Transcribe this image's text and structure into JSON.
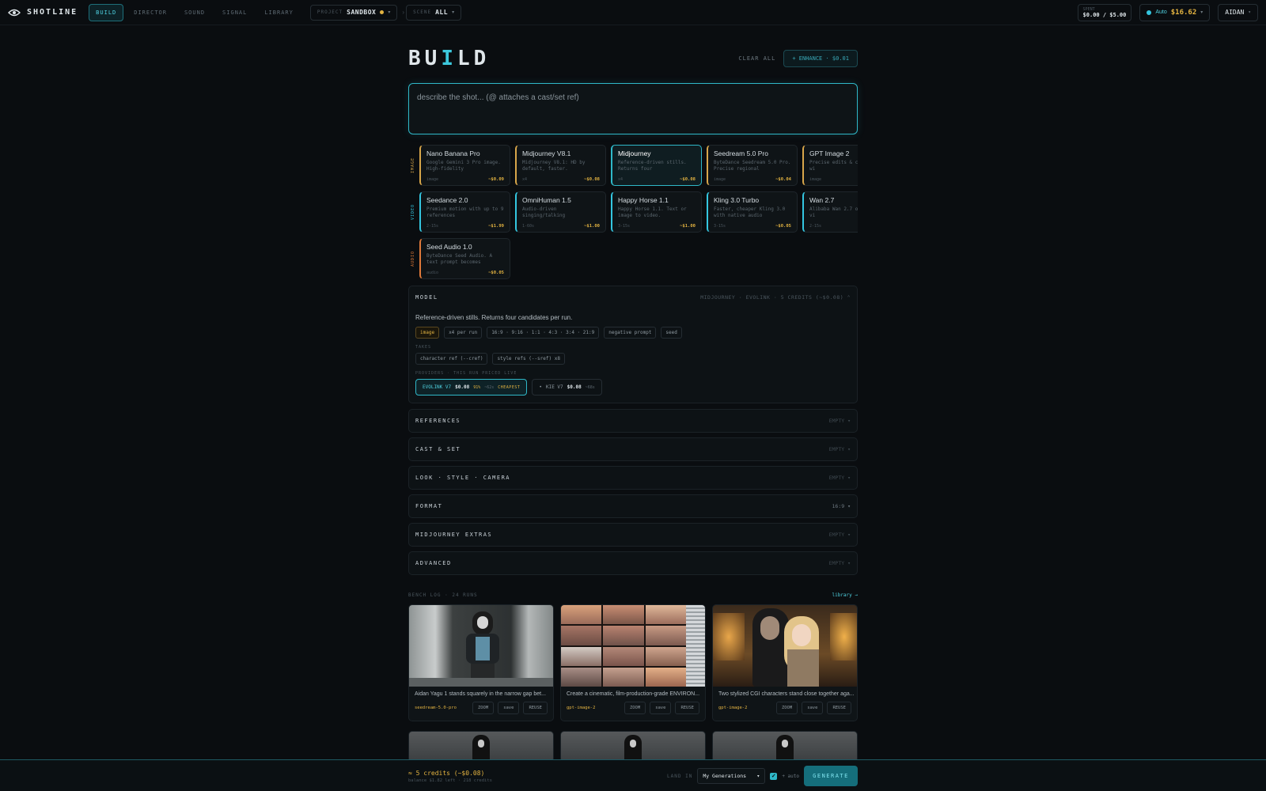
{
  "app": {
    "name": "SHOTLINE"
  },
  "nav": [
    {
      "label": "BUILD",
      "active": true
    },
    {
      "label": "DIRECTOR"
    },
    {
      "label": "SOUND"
    },
    {
      "label": "SIGNAL"
    },
    {
      "label": "LIBRARY"
    }
  ],
  "project": {
    "label": "PROJECT",
    "value": "SANDBOX"
  },
  "scene": {
    "label": "SCENE",
    "value": "ALL"
  },
  "spent": {
    "label": "SPENT",
    "value": "$0.00 / $5.00"
  },
  "auto": {
    "label": "Auto",
    "amount": "$16.62"
  },
  "user": {
    "name": "AIDAN"
  },
  "page": {
    "title_a": "BU",
    "title_hl": "I",
    "title_b": "LD",
    "clear_label": "CLEAR ALL",
    "enhance_label": "+ ENHANCE · $0.01"
  },
  "prompt": {
    "placeholder": "describe the shot... (@ attaches a cast/set ref)"
  },
  "model_groups": [
    {
      "label": "IMAGE",
      "models": [
        {
          "name": "Nano Banana Pro",
          "desc": "Google Gemini 3 Pro image. High-fidelity",
          "tag": "image",
          "price": "~$0.09"
        },
        {
          "name": "Midjourney V8.1",
          "desc": "Midjourney V8.1: HD by default, faster.",
          "tag": "x4",
          "price": "~$0.08"
        },
        {
          "name": "Midjourney",
          "desc": "Reference-driven stills. Returns four",
          "tag": "x4",
          "price": "~$0.08",
          "selected": true
        },
        {
          "name": "Seedream 5.0 Pro",
          "desc": "ByteDance Seedream 5.0 Pro. Precise regional",
          "tag": "image",
          "price": "~$0.04"
        },
        {
          "name": "GPT Image 2",
          "desc": "Precise edits & composition wi",
          "tag": "image",
          "price": ""
        }
      ]
    },
    {
      "label": "VIDEO",
      "models": [
        {
          "name": "Seedance 2.0",
          "desc": "Premium motion with up to 9 references",
          "tag": "2-15s",
          "price": "~$1.99"
        },
        {
          "name": "OmniHuman 1.5",
          "desc": "Audio-driven singing/talking",
          "tag": "1-60s",
          "price": "~$1.00"
        },
        {
          "name": "Happy Horse 1.1",
          "desc": "Happy Horse 1.1. Text or image to video.",
          "tag": "3-15s",
          "price": "~$1.00"
        },
        {
          "name": "Kling 3.0 Turbo",
          "desc": "Faster, cheaper Kling 3.0 with native audio",
          "tag": "3-15s",
          "price": "~$0.05"
        },
        {
          "name": "Wan 2.7",
          "desc": "Alibaba Wan 2.7 or image to vi",
          "tag": "2-15s",
          "price": ""
        }
      ]
    },
    {
      "label": "AUDIO",
      "models": [
        {
          "name": "Seed Audio 1.0",
          "desc": "ByteDance Seed Audio. A text prompt becomes",
          "tag": "audio",
          "price": "~$0.05"
        }
      ]
    }
  ],
  "model_panel": {
    "title": "MODEL",
    "meta": "MIDJOURNEY · EVOLINK · 5 CREDITS (~$0.08)",
    "description": "Reference-driven stills. Returns four candidates per run.",
    "chips": [
      "image",
      "x4 per run",
      "16:9 · 9:16 · 1:1 · 4:3 · 3:4 · 21:9",
      "negative prompt",
      "seed"
    ],
    "takes_label": "TAKES",
    "takes": [
      "character ref (--cref)",
      "style refs (--sref) x8"
    ],
    "providers_label": "PROVIDERS · THIS RUN PRICED LIVE",
    "providers": [
      {
        "name": "EVOLINK V7",
        "price": "$0.08",
        "uptime": "91%",
        "time": "~62s",
        "badge": "CHEAPEST",
        "selected": true
      },
      {
        "name": "KIE V7",
        "price": "$0.08",
        "time": "~68s",
        "prefix": "•"
      }
    ]
  },
  "sections": [
    {
      "title": "REFERENCES",
      "value": "EMPTY"
    },
    {
      "title": "CAST & SET",
      "value": "EMPTY"
    },
    {
      "title": "LOOK · STYLE · CAMERA",
      "value": "EMPTY"
    },
    {
      "title": "FORMAT",
      "value": "16:9"
    },
    {
      "title": "MIDJOURNEY EXTRAS",
      "value": "EMPTY"
    },
    {
      "title": "ADVANCED",
      "value": "EMPTY"
    }
  ],
  "bench": {
    "title": "BENCH LOG · 24 RUNS",
    "link": "library →",
    "items": [
      {
        "caption": "Aidan Yagu 1 stands squarely in the narrow gap bet...",
        "model": "seedream-5.0-pro"
      },
      {
        "caption": "Create a cinematic, film-production-grade ENVIRON...",
        "model": "gpt-image-2"
      },
      {
        "caption": "Two stylized CGI characters stand close together aga...",
        "model": "gpt-image-2"
      }
    ],
    "buttons": {
      "zoom": "ZOOM",
      "save": "save",
      "reuse": "REUSE"
    }
  },
  "bottom": {
    "credits": "≈ 5 credits (~$0.08)",
    "balance": "balance $1.82 left · 218 credits",
    "land_label": "LAND IN",
    "land_value": "My Generations",
    "auto_label": "+ auto",
    "generate_label": "GENERATE"
  },
  "colors": {
    "accent": "#2fb8c8",
    "gold": "#e3b341",
    "bg": "#0a0d10"
  }
}
